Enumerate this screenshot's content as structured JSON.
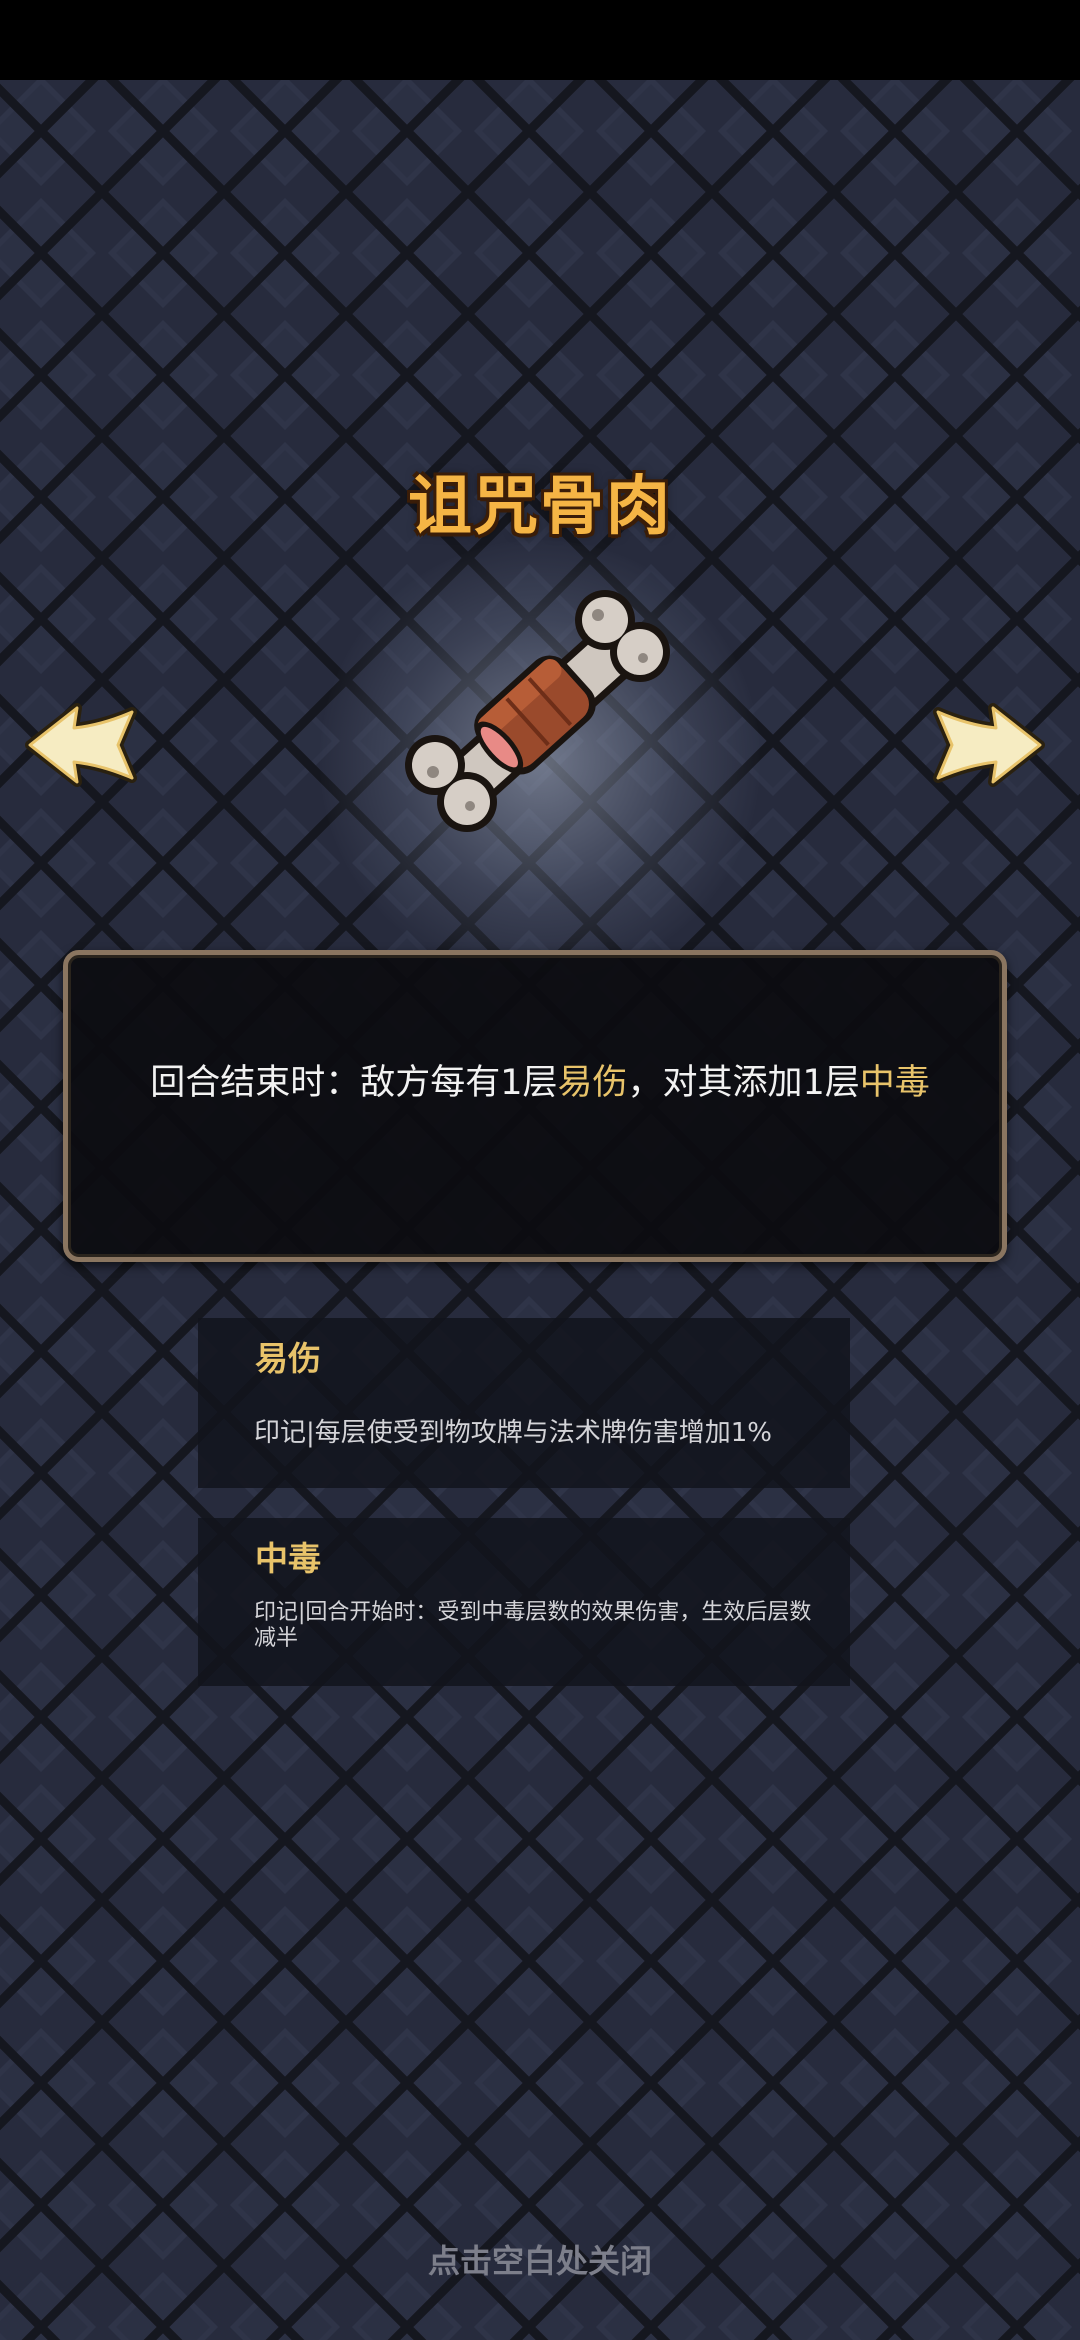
{
  "relic": {
    "name": "诅咒骨肉",
    "icon": "bone-meat-icon",
    "description": {
      "part1": "回合结束时：敌方每有1层",
      "kw1": "易伤",
      "part2": "，对其添加1层",
      "kw2": "中毒"
    }
  },
  "keywords": [
    {
      "name": "易伤",
      "description": "印记|每层使受到物攻牌与法术牌伤害增加1%"
    },
    {
      "name": "中毒",
      "description": "印记|回合开始时：受到中毒层数的效果伤害，生效后层数减半"
    }
  ],
  "navigation": {
    "prev_icon": "left-arrow-icon",
    "next_icon": "right-arrow-icon"
  },
  "footer": {
    "close_hint": "点击空白处关闭"
  },
  "colors": {
    "title": "#f5b545",
    "keyword": "#e8c36a",
    "background": "#262a3c"
  }
}
